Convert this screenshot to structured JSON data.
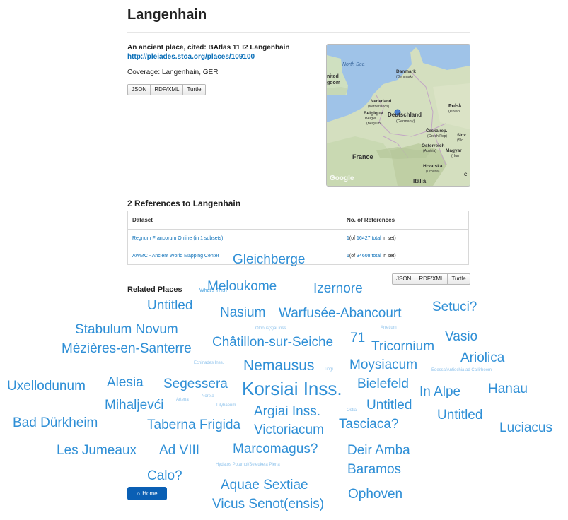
{
  "page": {
    "title": "Langenhain",
    "cited": "An ancient place, cited: BAtlas 11 I2 Langenhain",
    "uri": "http://pleiades.stoa.org/places/109100",
    "coverage": "Coverage: Langenhain, GER"
  },
  "formats": [
    "JSON",
    "RDF/XML",
    "Turtle"
  ],
  "map": {
    "labels": {
      "north_sea": "North Sea",
      "uk1": "nited",
      "uk2": "gdom",
      "danmark": "Danmark",
      "denmark": "(Denmark)",
      "polska": "Polsk",
      "poland": "(Polan",
      "nederland": "Nederland",
      "netherlands": "(Netherlands)",
      "belgique": "Belgique",
      "belgie": "België",
      "belgium": "(Belgium)",
      "deutschland": "Deutschland",
      "germany": "(Germany)",
      "cesko": "Česká rep.",
      "czech": "(Czech Rep)",
      "slov": "Slov",
      "slov2": "(Slo",
      "osterreich": "Österreich",
      "austria": "(Austria)",
      "magyar": "Magyar",
      "hung": "(Hun",
      "france": "France",
      "hrvatska": "Hrvatska",
      "croatia": "(Croatia)",
      "italia": "Italia",
      "google": "Google",
      "c": "C"
    }
  },
  "references": {
    "title": "2 References to Langenhain",
    "headers": [
      "Dataset",
      "No. of References"
    ],
    "rows": [
      {
        "dataset": "Regnum Francorum Online (in 1 subsets)",
        "count": "1",
        "of_pre": "(of ",
        "total": "16427 total",
        "post": " in set)"
      },
      {
        "dataset": "AWMC - Ancient World Mapping Center",
        "count": "1",
        "of_pre": "(of ",
        "total": "34608 total",
        "post": " in set)"
      }
    ]
  },
  "related": {
    "title": "Related Places",
    "whats_this": "What's This?",
    "colors": {
      "strong": "#2f8fd6",
      "faint": "#8fc3ec"
    },
    "places": [
      "Gleichberge",
      "Meloukome",
      "Izernore",
      "Untitled",
      "Nasium",
      "Warfusée-Abancourt",
      "Setuci?",
      "Stabulum Novum",
      "Olnous(s)ai Inss.",
      "Arretium",
      "Vasio",
      "Mézières-en-Santerre",
      "Châtillon-sur-Seiche",
      "71",
      "Tricornium",
      "Ariolica",
      "Echinades Inss.",
      "Nemausus",
      "Tingi",
      "Moysiacum",
      "Edessa/Antiochia ad Callirhoem",
      "Uxellodunum",
      "Alesia",
      "Segessera",
      "Korsiai Inss.",
      "Bielefeld",
      "Hanau",
      "In Alpe",
      "Artena",
      "Noreia",
      "Lilybaeum",
      "Mihaljevći",
      "Untitled",
      "Argiai Inss.",
      "Ostia",
      "Untitled",
      "Bad Dürkheim",
      "Taberna Frigida",
      "Victoriacum",
      "Tasciaca?",
      "Luciacus",
      "Les Jumeaux",
      "Ad VIII",
      "Marcomagus?",
      "Deir Amba",
      "Hydatos Potamoi/Seleukeia Pieria",
      "Baramos",
      "Calo?",
      "Aquae Sextiae",
      "Ophoven",
      "Vicus Senot(ensis)"
    ]
  },
  "nav": {
    "home": "Home"
  }
}
